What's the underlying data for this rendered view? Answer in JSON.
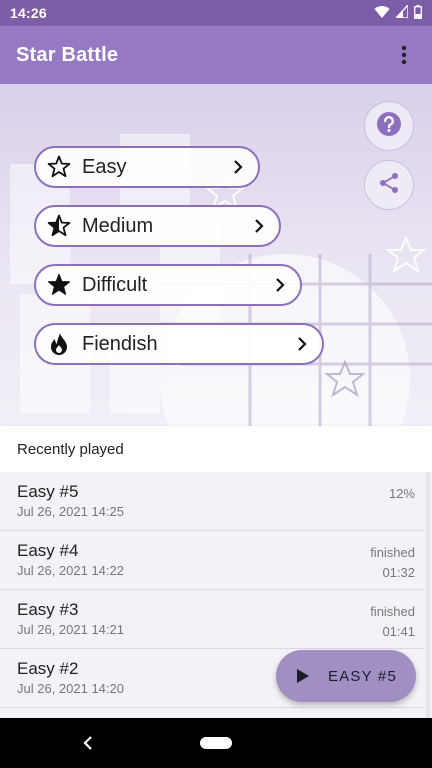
{
  "status_bar": {
    "time": "14:26",
    "icons": [
      "wifi-icon",
      "signal-icon",
      "battery-icon"
    ]
  },
  "app_bar": {
    "title": "Star Battle",
    "menu_icon": "more-vert-icon"
  },
  "difficulties": [
    {
      "label": "Easy",
      "icon": "star-outline-icon"
    },
    {
      "label": "Medium",
      "icon": "star-half-icon"
    },
    {
      "label": "Difficult",
      "icon": "star-filled-icon"
    },
    {
      "label": "Fiendish",
      "icon": "flame-icon"
    }
  ],
  "side_buttons": {
    "help_icon": "help-icon",
    "share_icon": "share-icon"
  },
  "recent": {
    "header": "Recently played",
    "items": [
      {
        "name": "Easy #5",
        "date": "Jul 26, 2021 14:25",
        "status": "12%",
        "duration": ""
      },
      {
        "name": "Easy #4",
        "date": "Jul 26, 2021 14:22",
        "status": "finished",
        "duration": "01:32"
      },
      {
        "name": "Easy #3",
        "date": "Jul 26, 2021 14:21",
        "status": "finished",
        "duration": "01:41"
      },
      {
        "name": "Easy #2",
        "date": "Jul 26, 2021 14:20",
        "status": "",
        "duration": ""
      }
    ]
  },
  "play_fab": {
    "label": "EASY #5",
    "icon": "play-icon"
  },
  "colors": {
    "status_bar": "#7d5ca8",
    "app_bar": "#9679c3",
    "accent": "#8e6fbd",
    "fab": "#9f8fc3"
  }
}
